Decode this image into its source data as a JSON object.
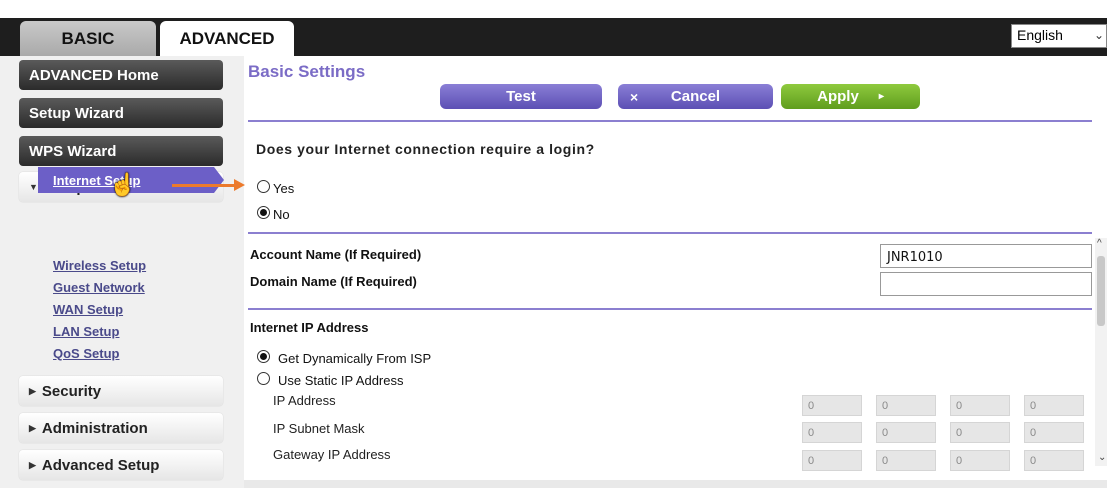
{
  "tabs": {
    "basic": "BASIC",
    "advanced": "ADVANCED"
  },
  "language": {
    "selected": "English",
    "chevron": "⌄"
  },
  "sidebar": {
    "advanced_home": "ADVANCED Home",
    "setup_wizard": "Setup Wizard",
    "wps_wizard": "WPS Wizard",
    "setup": "Setup",
    "setup_items": [
      "Internet Setup",
      "Wireless Setup",
      "Guest Network",
      "WAN Setup",
      "LAN Setup",
      "QoS Setup"
    ],
    "security": "Security",
    "administration": "Administration",
    "advanced_setup": "Advanced Setup"
  },
  "main": {
    "title": "Basic Settings",
    "buttons": {
      "test": "Test",
      "cancel": "Cancel",
      "cancel_icon": "×",
      "apply": "Apply",
      "apply_icon": "▸"
    },
    "login_question": "Does your Internet connection require a login?",
    "login_options": {
      "yes": "Yes",
      "no": "No",
      "selected": "no"
    },
    "account_name_label": "Account Name (If Required)",
    "account_name_value": "JNR1010",
    "domain_name_label": "Domain Name (If Required)",
    "domain_name_value": "",
    "ip_section_title": "Internet IP Address",
    "ip_options": {
      "dynamic": "Get Dynamically From ISP",
      "static": "Use Static IP Address",
      "selected": "dynamic"
    },
    "ip_fields": [
      {
        "label": "IP Address",
        "octets": [
          "0",
          "0",
          "0",
          "0"
        ]
      },
      {
        "label": "IP Subnet Mask",
        "octets": [
          "0",
          "0",
          "0",
          "0"
        ]
      },
      {
        "label": "Gateway IP Address",
        "octets": [
          "0",
          "0",
          "0",
          "0"
        ]
      }
    ]
  },
  "colors": {
    "accent": "#6c5fc7",
    "apply": "#7ab52f",
    "arrow": "#ec7a2c",
    "topbar": "#1e1e1e"
  },
  "icons": [
    "chevron-down-icon",
    "triangle-down-icon",
    "triangle-right-icon",
    "close-icon",
    "arrow-right-icon",
    "hand-cursor-icon",
    "annotation-arrow-icon"
  ]
}
